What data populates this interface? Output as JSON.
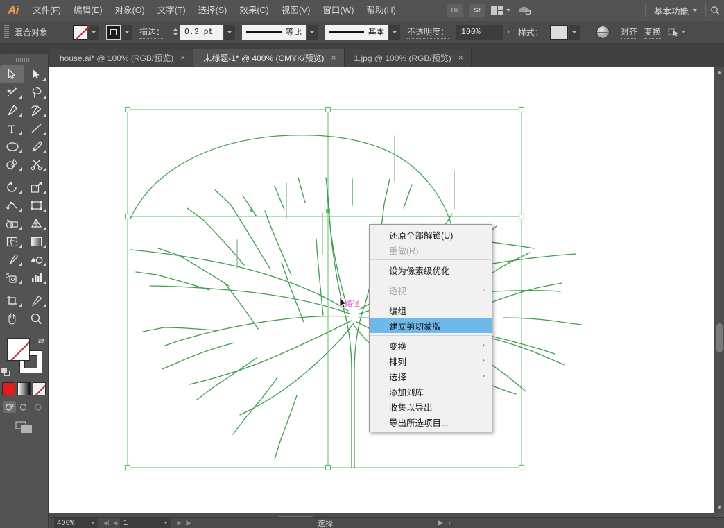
{
  "app": {
    "name": "Ai",
    "logo_text": "Ai"
  },
  "menubar": {
    "items": [
      {
        "label": "文件(F)",
        "name": "menu-file"
      },
      {
        "label": "编辑(E)",
        "name": "menu-edit"
      },
      {
        "label": "对象(O)",
        "name": "menu-object"
      },
      {
        "label": "文字(T)",
        "name": "menu-type"
      },
      {
        "label": "选择(S)",
        "name": "menu-select"
      },
      {
        "label": "效果(C)",
        "name": "menu-effect"
      },
      {
        "label": "视图(V)",
        "name": "menu-view"
      },
      {
        "label": "窗口(W)",
        "name": "menu-window"
      },
      {
        "label": "帮助(H)",
        "name": "menu-help"
      }
    ],
    "bridge_icon": "Br",
    "stock_icon": "St",
    "arrange_icon": "arrange-documents-icon",
    "cc_icon": "creative-cloud-icon",
    "workspace": "基本功能",
    "search_icon": "search-icon"
  },
  "controlbar": {
    "object_label": "混合对象",
    "fill_swatch": "none-swatch",
    "stroke_swatch": "stroke-swatch",
    "stroke_label": "描边：",
    "stroke_weight": "0.3 pt",
    "profile_value": "等比",
    "brush_value": "基本",
    "opacity_label": "不透明度：",
    "opacity_value": "100%",
    "style_label": "样式：",
    "align_label": "对齐",
    "transform_label": "变换",
    "recolor_icon": "recolor-artwork-icon",
    "anchor_icon": "select-similar-icon"
  },
  "tabs": [
    {
      "label": "house.ai* @ 100% (RGB/预览)",
      "active": false,
      "close": "×"
    },
    {
      "label": "未标题-1* @ 400% (CMYK/预览)",
      "active": true,
      "close": "×"
    },
    {
      "label": "1.jpg @ 100% (RGB/预览)",
      "active": false,
      "close": "×"
    }
  ],
  "toolbar": {
    "tools": [
      {
        "name": "selection-tool",
        "selected": true
      },
      {
        "name": "direct-selection-tool",
        "selected": false
      },
      {
        "name": "magic-wand-tool",
        "selected": false
      },
      {
        "name": "lasso-tool",
        "selected": false
      },
      {
        "name": "pen-tool",
        "selected": false
      },
      {
        "name": "curvature-tool",
        "selected": false
      },
      {
        "name": "type-tool",
        "selected": false
      },
      {
        "name": "line-segment-tool",
        "selected": false
      },
      {
        "name": "ellipse-tool",
        "selected": false
      },
      {
        "name": "paintbrush-tool",
        "selected": false
      },
      {
        "name": "shaper-tool",
        "selected": false
      },
      {
        "name": "scissors-tool",
        "selected": false
      },
      {
        "name": "rotate-tool",
        "selected": false
      },
      {
        "name": "scale-tool",
        "selected": false
      },
      {
        "name": "width-tool",
        "selected": false
      },
      {
        "name": "free-transform-tool",
        "selected": false
      },
      {
        "name": "shape-builder-tool",
        "selected": false
      },
      {
        "name": "perspective-grid-tool",
        "selected": false
      },
      {
        "name": "mesh-tool",
        "selected": false
      },
      {
        "name": "gradient-tool",
        "selected": false
      },
      {
        "name": "eyedropper-tool",
        "selected": false
      },
      {
        "name": "blend-tool",
        "selected": false
      },
      {
        "name": "symbol-sprayer-tool",
        "selected": false
      },
      {
        "name": "column-graph-tool",
        "selected": false
      },
      {
        "name": "artboard-tool",
        "selected": false
      },
      {
        "name": "slice-tool",
        "selected": false
      },
      {
        "name": "hand-tool",
        "selected": false
      },
      {
        "name": "zoom-tool",
        "selected": false
      }
    ],
    "fill_name": "fill-swatch-none",
    "stroke_name": "stroke-swatch-black",
    "swap_icon": "swap-fill-stroke-icon",
    "default_icon": "default-fill-stroke-icon",
    "modes": [
      "color-mode",
      "gradient-mode",
      "none-mode"
    ],
    "draw_modes": [
      "draw-normal",
      "draw-behind",
      "draw-inside"
    ],
    "screen_mode": "change-screen-mode-icon"
  },
  "canvas": {
    "artboard_label": "artboard",
    "smart_guide_label": "路径",
    "selection_color": "#5fc16a",
    "artwork_color": "#3f9e4d"
  },
  "contextmenu": {
    "items": [
      {
        "label": "还原全部解锁(U)",
        "name": "ctx-undo-unlock-all",
        "disabled": false,
        "highlight": false,
        "submenu": false,
        "sep_after": false
      },
      {
        "label": "重做(R)",
        "name": "ctx-redo",
        "disabled": true,
        "highlight": false,
        "submenu": false,
        "sep_after": true
      },
      {
        "label": "设为像素级优化",
        "name": "ctx-make-pixel-perfect",
        "disabled": false,
        "highlight": false,
        "submenu": false,
        "sep_after": true
      },
      {
        "label": "透视",
        "name": "ctx-perspective",
        "disabled": true,
        "highlight": false,
        "submenu": true,
        "sep_after": true
      },
      {
        "label": "编组",
        "name": "ctx-group",
        "disabled": false,
        "highlight": false,
        "submenu": false,
        "sep_after": false
      },
      {
        "label": "建立剪切蒙版",
        "name": "ctx-make-clipping-mask",
        "disabled": false,
        "highlight": true,
        "submenu": false,
        "sep_after": true
      },
      {
        "label": "变换",
        "name": "ctx-transform",
        "disabled": false,
        "highlight": false,
        "submenu": true,
        "sep_after": false
      },
      {
        "label": "排列",
        "name": "ctx-arrange",
        "disabled": false,
        "highlight": false,
        "submenu": true,
        "sep_after": false
      },
      {
        "label": "选择",
        "name": "ctx-select",
        "disabled": false,
        "highlight": false,
        "submenu": true,
        "sep_after": false
      },
      {
        "label": "添加到库",
        "name": "ctx-add-to-library",
        "disabled": false,
        "highlight": false,
        "submenu": false,
        "sep_after": false
      },
      {
        "label": "收集以导出",
        "name": "ctx-collect-for-export",
        "disabled": false,
        "highlight": false,
        "submenu": false,
        "sep_after": false
      },
      {
        "label": "导出所选项目...",
        "name": "ctx-export-selection",
        "disabled": false,
        "highlight": false,
        "submenu": false,
        "sep_after": false
      }
    ],
    "submenu_arrow": "›"
  },
  "statusbar": {
    "zoom": "400%",
    "page": "1",
    "status_text": "选择",
    "first_icon": "first-page-icon",
    "prev_icon": "prev-page-icon",
    "next_icon": "next-page-icon",
    "last_icon": "last-page-icon"
  }
}
